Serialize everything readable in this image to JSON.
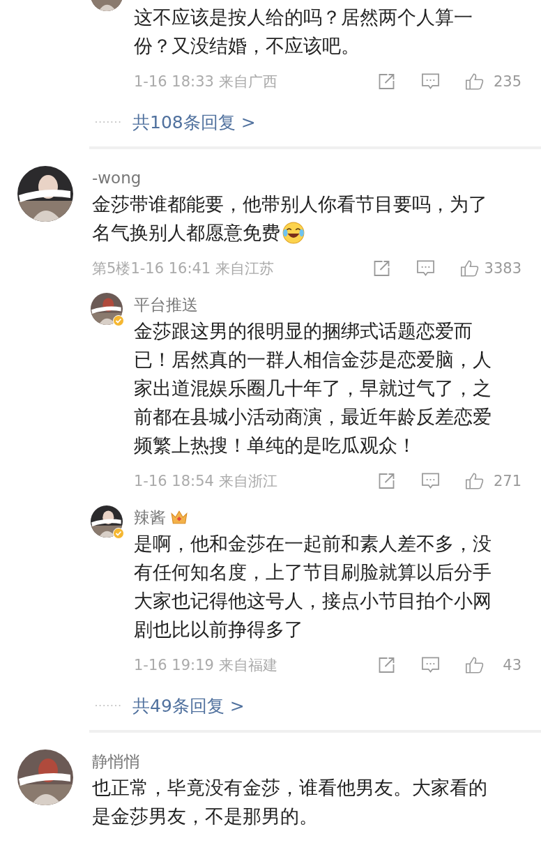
{
  "entries": [
    {
      "kind": "reply",
      "text": [
        "这不应该是按人给的吗？居然两个人算一",
        "份？又没结婚，不应该吧。"
      ],
      "time": "1-16 18:33",
      "location": "来自广西",
      "likes": "235"
    },
    {
      "kind": "more",
      "label": "共108条回复 >"
    },
    {
      "kind": "divider"
    },
    {
      "kind": "comment",
      "name": "-wong",
      "text": [
        "金莎带谁都能要，他带别人你看节目要吗，为了",
        "名气换别人都愿意免费"
      ],
      "emoji": true,
      "floor": "第5楼",
      "time": "1-16 16:41",
      "location": "来自江苏",
      "likes": "3383"
    },
    {
      "kind": "reply",
      "name": "平台推送",
      "text": [
        "金莎跟这男的很明显的捆绑式话题恋爱而",
        "已！居然真的一群人相信金莎是恋爱脑，人",
        "家出道混娱乐圈几十年了，早就过气了，之",
        "前都在县城小活动商演，最近年龄反差恋爱",
        "频繁上热搜！单纯的是吃瓜观众！"
      ],
      "time": "1-16 18:54",
      "location": "来自浙江",
      "likes": "271",
      "verified": true
    },
    {
      "kind": "reply",
      "name": "辣酱",
      "text": [
        "是啊，他和金莎在一起前和素人差不多，没",
        "有任何知名度，上了节目刷脸就算以后分手",
        "大家也记得他这号人，接点小节目拍个小网",
        "剧也比以前挣得多了"
      ],
      "time": "1-16 19:19",
      "location": "来自福建",
      "likes": "43",
      "verified": true,
      "badge": true
    },
    {
      "kind": "more",
      "label": "共49条回复 >"
    },
    {
      "kind": "divider"
    },
    {
      "kind": "comment",
      "name": "静悄悄",
      "text": [
        "也正常，毕竟没有金莎，谁看他男友。大家看的",
        "是金莎男友，不是那男的。"
      ]
    }
  ]
}
